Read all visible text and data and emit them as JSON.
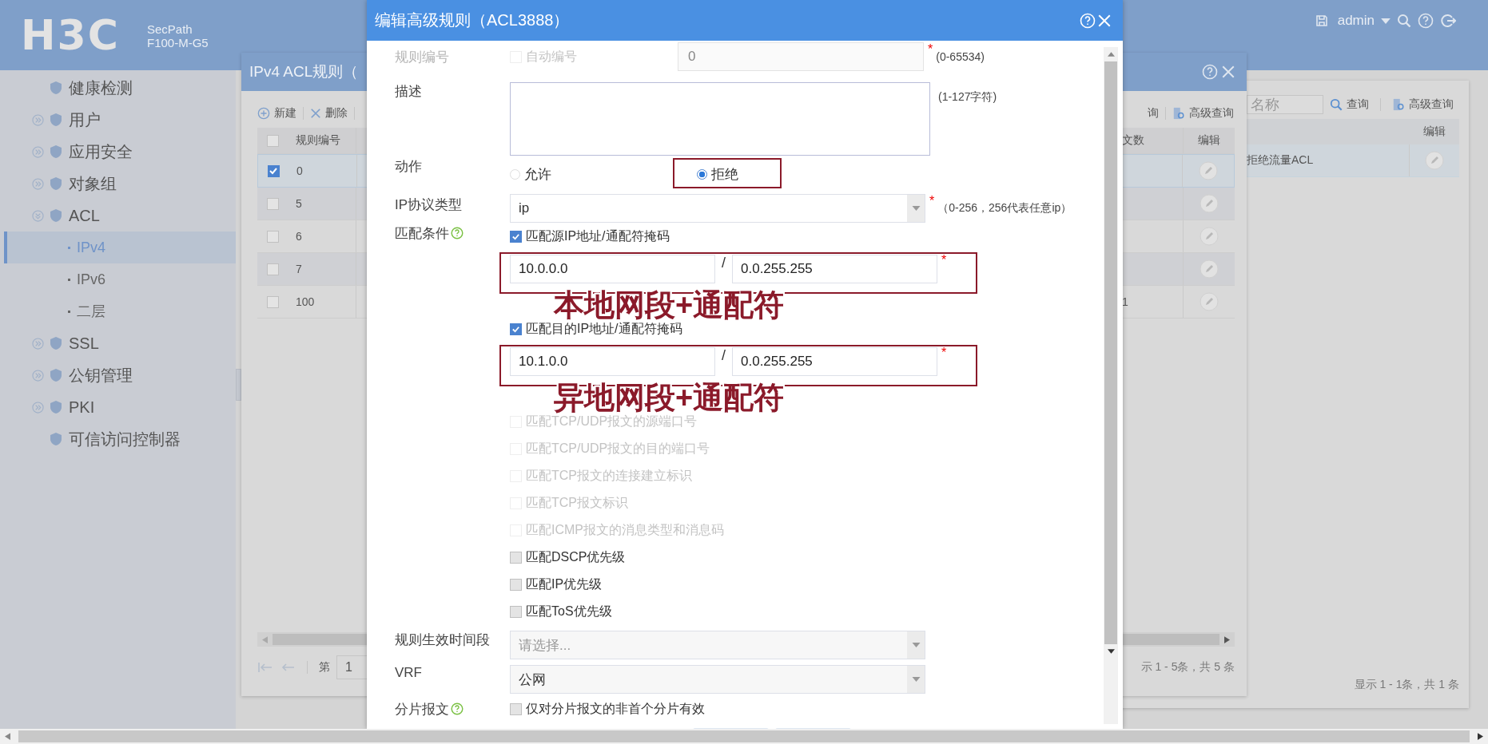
{
  "header": {
    "logo": "H3C",
    "product": "SecPath",
    "model": "F100-M-G5",
    "user": "admin"
  },
  "sidebar": {
    "items": [
      {
        "label": "健康检测",
        "selected": false
      },
      {
        "label": "用户",
        "selected": false,
        "expanded": false
      },
      {
        "label": "应用安全",
        "selected": false,
        "expanded": false
      },
      {
        "label": "对象组",
        "selected": false,
        "expanded": false
      },
      {
        "label": "ACL",
        "selected": false,
        "expanded": true,
        "children": [
          {
            "label": "IPv4",
            "selected": true
          },
          {
            "label": "IPv6",
            "selected": false
          },
          {
            "label": "二层",
            "selected": false
          }
        ]
      },
      {
        "label": "SSL",
        "selected": false,
        "expanded": false
      },
      {
        "label": "公钥管理",
        "selected": false,
        "expanded": false
      },
      {
        "label": "PKI",
        "selected": false,
        "expanded": false
      },
      {
        "label": "可信访问控制器",
        "selected": false
      }
    ]
  },
  "list_window": {
    "search_placeholder": "名称",
    "search_button": "查询",
    "advanced_button": "高级查询",
    "columns": [
      "编辑"
    ],
    "rows": [
      {
        "description": "拒绝流量ACL",
        "selected": true
      }
    ],
    "footer": "显示 1 - 1条，共 1 条"
  },
  "rules_window": {
    "title": "IPv4 ACL规则（",
    "toolbar": [
      {
        "label": "新建",
        "kind": "add"
      },
      {
        "label": "删除",
        "kind": "delete"
      }
    ],
    "toolbar_right": [
      {
        "label": "询",
        "kind": "text"
      },
      {
        "label": "高级查询",
        "kind": "advanced"
      }
    ],
    "all_checked": false,
    "columns": [
      "规则编号",
      "文数",
      "编辑"
    ],
    "rows": [
      {
        "id": "0",
        "selected": true
      },
      {
        "id": "5",
        "selected": false
      },
      {
        "id": "6",
        "selected": false
      },
      {
        "id": "7",
        "selected": false
      },
      {
        "id": "100",
        "selected": false,
        "count": "1"
      }
    ],
    "pager": {
      "label": "第",
      "page": "1"
    },
    "footer": "示 1 - 5条，共 5 条"
  },
  "dialog": {
    "title": "编辑高级规则（ACL3888）",
    "rule_id": {
      "label": "规则编号",
      "auto_label": "自动编号",
      "auto_checked": false,
      "disabled": true,
      "value": "0",
      "required_mark": "*",
      "hint": "(0-65534)"
    },
    "description": {
      "label": "描述",
      "hint": "(1-127字符)"
    },
    "action": {
      "label": "动作",
      "options": [
        {
          "label": "允许",
          "selected": false,
          "highlighted": false
        },
        {
          "label": "拒绝",
          "selected": true,
          "highlighted": true
        }
      ]
    },
    "protocol": {
      "label": "IP协议类型",
      "value": "ip",
      "required_mark": "*",
      "hint": "（0-256，256代表任意ip）"
    },
    "match": {
      "label": "匹配条件",
      "conditions": [
        {
          "kind": "checkbox",
          "label": "匹配源IP地址/通配符掩码",
          "checked": true,
          "disabled": false
        },
        {
          "kind": "address",
          "address": "10.0.0.0",
          "separator": "/",
          "wildcard": "0.0.255.255",
          "required_mark": "*",
          "highlighted": true,
          "annotation": "本地网段+通配符"
        },
        {
          "kind": "checkbox",
          "label": "匹配目的IP地址/通配符掩码",
          "checked": true,
          "disabled": false
        },
        {
          "kind": "address",
          "address": "10.1.0.0",
          "separator": "/",
          "wildcard": "0.0.255.255",
          "required_mark": "*",
          "highlighted": true,
          "annotation": "异地网段+通配符"
        },
        {
          "kind": "checkbox",
          "label": "匹配TCP/UDP报文的源端口号",
          "checked": false,
          "disabled": true
        },
        {
          "kind": "checkbox",
          "label": "匹配TCP/UDP报文的目的端口号",
          "checked": false,
          "disabled": true
        },
        {
          "kind": "checkbox",
          "label": "匹配TCP报文的连接建立标识",
          "checked": false,
          "disabled": true
        },
        {
          "kind": "checkbox",
          "label": "匹配TCP报文标识",
          "checked": false,
          "disabled": true
        },
        {
          "kind": "checkbox",
          "label": "匹配ICMP报文的消息类型和消息码",
          "checked": false,
          "disabled": true
        },
        {
          "kind": "checkbox",
          "label": "匹配DSCP优先级",
          "checked": false,
          "disabled": false
        },
        {
          "kind": "checkbox",
          "label": "匹配IP优先级",
          "checked": false,
          "disabled": false
        },
        {
          "kind": "checkbox",
          "label": "匹配ToS优先级",
          "checked": false,
          "disabled": false
        }
      ]
    },
    "time_range": {
      "label": "规则生效时间段",
      "placeholder": "请选择..."
    },
    "vrf": {
      "label": "VRF",
      "value": "公网"
    },
    "fragment": {
      "label": "分片报文",
      "option": "仅对分片报文的非首个分片有效",
      "checked": false
    }
  }
}
